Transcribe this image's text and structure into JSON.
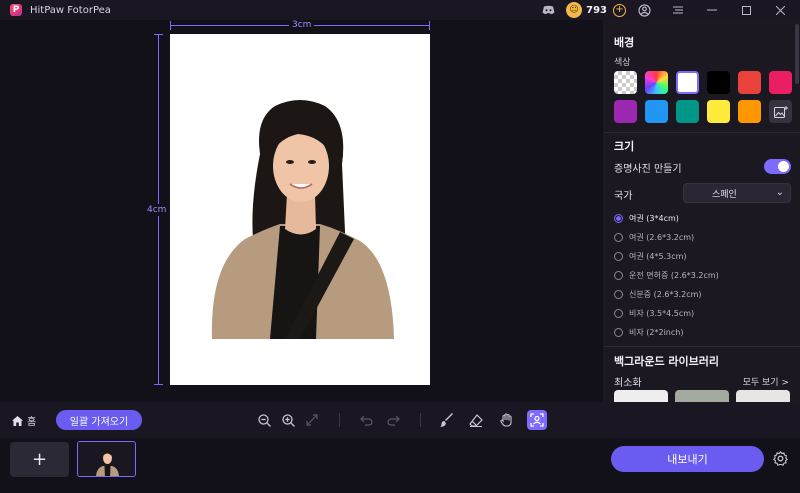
{
  "app": {
    "title": "HitPaw FotorPea",
    "coins": "793"
  },
  "canvas": {
    "width_label": "3cm",
    "height_label": "4cm"
  },
  "panel": {
    "background_title": "배경",
    "color_label": "색상",
    "colors": [
      "transparent",
      "rainbow",
      "#ffffff",
      "#000000",
      "#e9423b",
      "#e91e63",
      "#9c27b0",
      "#2196f3",
      "#009688",
      "#ffeb3b",
      "#ff9800",
      "image-upload"
    ],
    "size_title": "크기",
    "id_photo_label": "증명사진 만들기",
    "country_label": "국가",
    "country_value": "스페인",
    "sizes": [
      {
        "label": "여권 (3*4cm)",
        "checked": true
      },
      {
        "label": "여권 (2.6*3.2cm)",
        "checked": false
      },
      {
        "label": "여권 (4*5.3cm)",
        "checked": false
      },
      {
        "label": "운전 면허증 (2.6*3.2cm)",
        "checked": false
      },
      {
        "label": "신분증 (2.6*3.2cm)",
        "checked": false
      },
      {
        "label": "비자 (3.5*4.5cm)",
        "checked": false
      },
      {
        "label": "비자 (2*2inch)",
        "checked": false
      }
    ],
    "library_title": "백그라운드 라이브러리",
    "recent_label": "최소화",
    "see_all_label": "모두 보기 >"
  },
  "toolbar": {
    "home_label": "홈",
    "import_label": "일괄 가져오기"
  },
  "bottom": {
    "export_label": "내보내기",
    "add_label": "+"
  },
  "colors": {
    "accent": "#7d6bff",
    "button": "#6a5cf0",
    "panel_bg": "#1b1822",
    "app_bg": "#121018"
  }
}
